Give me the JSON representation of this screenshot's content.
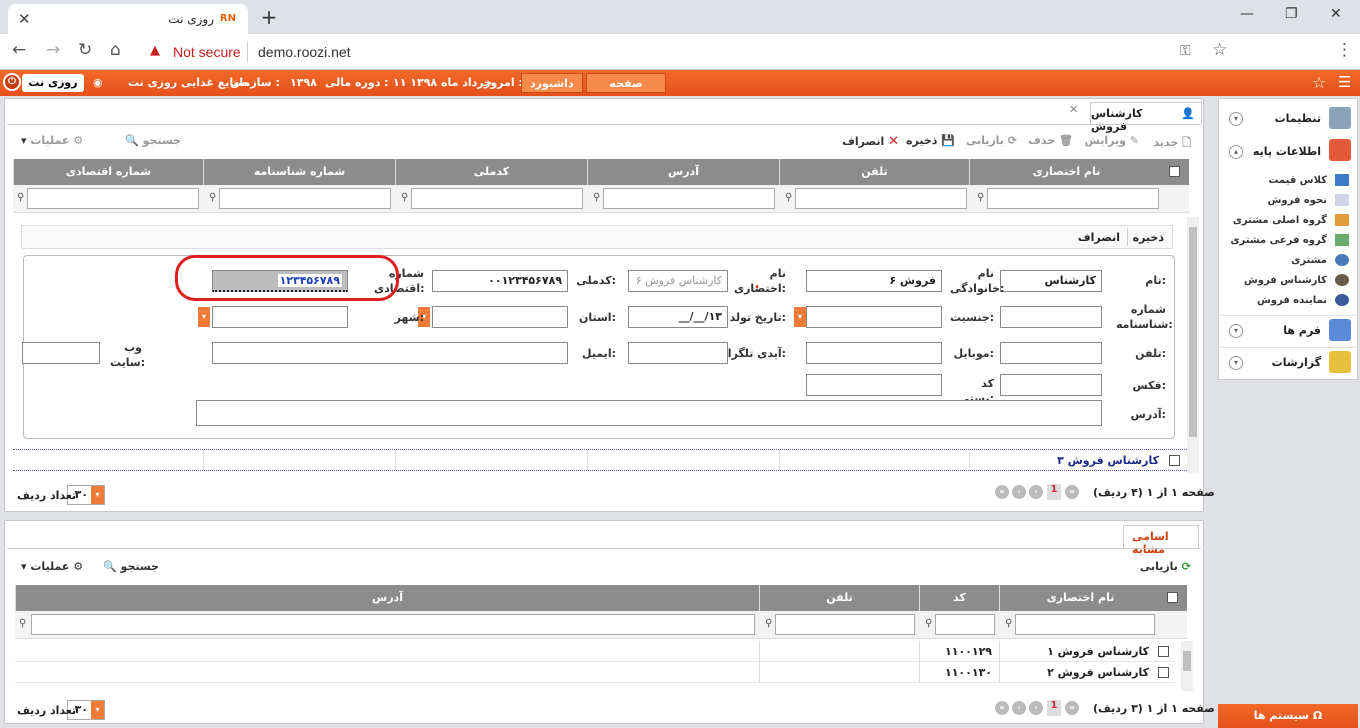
{
  "browser": {
    "tab_title": "روزی نت",
    "favicon_text": "RN",
    "new_tab": "+",
    "not_secure": "Not secure",
    "url": "demo.roozi.net"
  },
  "header": {
    "roozi_btn": "روزی نت",
    "org_label": "سازمان :",
    "org_value": "صنایع غذایی روزی نت",
    "fiscal_label": "دوره مالی :",
    "fiscal_value": "۱۳۹۸",
    "today_label": "امروز :",
    "today_value": "۱۱ خرداد ماه ۱۳۹۸",
    "dashboard": "داشبورد",
    "first_page": "صفحه نخست"
  },
  "main": {
    "tab_title": "کارشناس فروش",
    "toolbar": {
      "new": "جدید",
      "edit": "ویرایش",
      "delete": "حذف",
      "refresh": "بازیابی",
      "save": "ذخیره",
      "cancel": "انصراف",
      "search": "جستجو",
      "operations": "عملیات"
    },
    "columns": [
      "نام اختصاری",
      "تلفن",
      "آدرس",
      "کدملی",
      "شماره شناسنامه",
      "شماره اقتصادی"
    ],
    "form_actions": {
      "save": "ذخیره",
      "cancel": "انصراف"
    },
    "form": {
      "name_label": "نام:",
      "name_value": "کارشناس",
      "family_label": "نام خانوادگی:",
      "family_value": "فروش ۶",
      "short_name_label": "نام اختصاری:",
      "short_name_value": "کارشناس فروش ۶",
      "national_id_label": "کدملی:",
      "national_id_value": "۰۰۱۲۳۴۵۶۷۸۹",
      "economic_label": "شماره اقتصادی:",
      "economic_value": "۱۲۳۴۵۶۷۸۹",
      "id_number_label": "شماره شناسنامه:",
      "gender_label": "جنسیت:",
      "birth_label": "تاریخ تولد:",
      "birth_value": "__/__/۱۳",
      "province_label": "استان:",
      "city_label": "شهر:",
      "phone_label": "تلفن:",
      "mobile_label": "موبایل:",
      "telegram_label": "آیدی تلگرام:",
      "email_label": "ایمیل:",
      "website_label": "وب سایت:",
      "fax_label": "فکس:",
      "postal_label": "کد پستی:",
      "address_label": "آدرس:"
    },
    "selected_row": "کارشناس فروش ۳",
    "pager": "صفحه ۱ از ۱ (۴ ردیف)",
    "page_num": "1",
    "rows_count": "۳۰",
    "rows_label": "تعداد ردیف"
  },
  "similar": {
    "tab_title": "اسامی مشابه",
    "toolbar": {
      "refresh": "بازیابی",
      "search": "جستجو",
      "operations": "عملیات"
    },
    "columns": [
      "نام اختصاری",
      "کد",
      "تلفن",
      "آدرس"
    ],
    "rows": [
      {
        "name": "کارشناس فروش ۱",
        "code": "۱۱۰۰۱۲۹"
      },
      {
        "name": "کارشناس فروش ۲",
        "code": "۱۱۰۰۱۳۰"
      }
    ],
    "pager": "صفحه ۱ از ۱ (۳ ردیف)",
    "page_num": "1",
    "rows_count": "۳۰",
    "rows_label": "تعداد ردیف"
  },
  "sidebar": {
    "settings": "تنظیمات",
    "base_info": "اطلاعات پایه",
    "sub_items": [
      "کلاس قیمت",
      "نحوه فروش",
      "گروه اصلی مشتری",
      "گروه فرعی مشتری",
      "مشتری",
      "کارشناس فروش",
      "نماینده فروش"
    ],
    "forms": "فرم ها",
    "reports": "گزارشات",
    "system": "سیستم ها"
  },
  "colors": {
    "accent": "#e6501a",
    "grid_header": "#8c8c8c",
    "highlight": "#e02020"
  }
}
